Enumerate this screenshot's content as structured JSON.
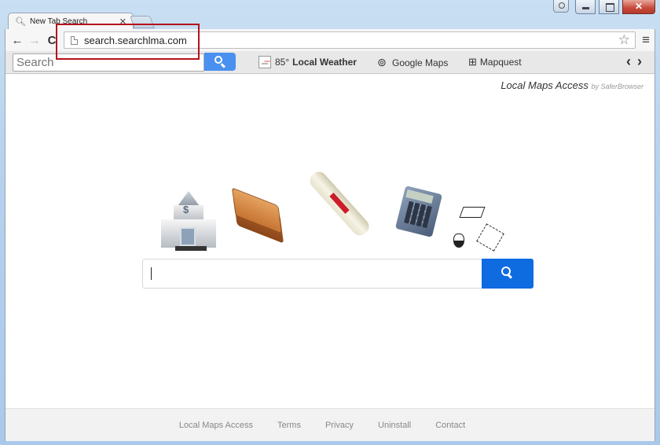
{
  "window": {
    "controls": [
      "profile",
      "minimize",
      "maximize",
      "close"
    ]
  },
  "tab": {
    "title": "New Tab Search",
    "icon": "search-icon",
    "close_glyph": "✕"
  },
  "nav": {
    "back_glyph": "←",
    "forward_glyph": "→",
    "reload_glyph": "C",
    "url": "search.searchlma.com",
    "star_glyph": "☆",
    "menu_glyph": "≡"
  },
  "toolbar": {
    "search_placeholder": "Search",
    "search_value": "",
    "weather_temp": "85°",
    "weather_label": "Local Weather",
    "google_maps_label": "Google Maps",
    "mapquest_label": "Mapquest",
    "prev_glyph": "‹",
    "next_glyph": "›",
    "pin_glyph": "⊚",
    "map_glyph": "⊞"
  },
  "page": {
    "brand_title": "Local Maps Access",
    "brand_by": "by SaferBrowser",
    "main_search_value": "",
    "illustrations": [
      "bank-icon",
      "books-icon",
      "diploma-scroll-icon",
      "calculator-icon",
      "science-doodle-icon"
    ]
  },
  "footer": {
    "links": [
      "Local Maps Access",
      "Terms",
      "Privacy",
      "Uninstall",
      "Contact"
    ]
  },
  "highlight": {
    "color": "#b3121c"
  }
}
